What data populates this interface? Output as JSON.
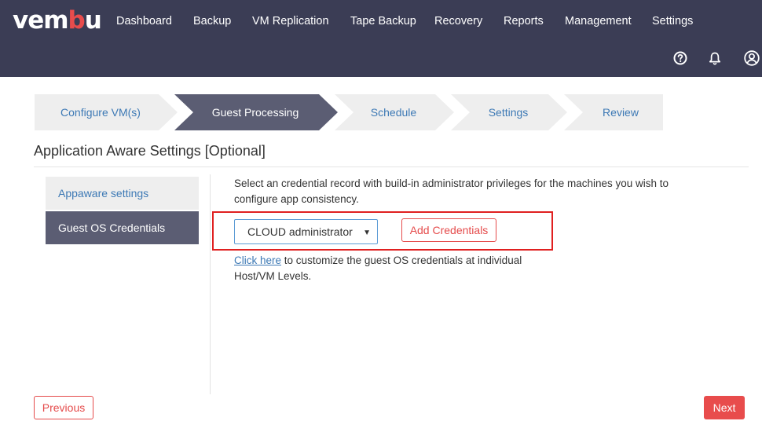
{
  "brand": {
    "logo_part1": "vem",
    "logo_part2": "b",
    "logo_part3": "u",
    "accent_color": "#e84c4c",
    "nav_bg_color": "#3b3d55"
  },
  "nav": {
    "items": [
      "Dashboard",
      "Backup",
      "VM Replication",
      "Tape Backup",
      "Recovery",
      "Reports",
      "Management",
      "Settings"
    ]
  },
  "utility_icons": [
    "help-icon",
    "bell-icon",
    "user-icon"
  ],
  "wizard": {
    "steps": [
      {
        "label": "Configure VM(s)",
        "state": "completed"
      },
      {
        "label": "Guest Processing",
        "state": "active"
      },
      {
        "label": "Schedule",
        "state": "pending"
      },
      {
        "label": "Settings",
        "state": "pending"
      },
      {
        "label": "Review",
        "state": "pending"
      }
    ]
  },
  "section": {
    "title": "Application Aware Settings [Optional]"
  },
  "sidebar": {
    "items": [
      {
        "label": "Appaware settings",
        "selected": false
      },
      {
        "label": "Guest OS Credentials",
        "selected": true
      }
    ]
  },
  "content": {
    "description": "Select an credential record with build-in administrator privileges for the machines you wish to configure app consistency.",
    "credential_select": {
      "selected": "CLOUD administrator"
    },
    "add_credentials_label": "Add Credentials",
    "click_here_link": "Click here",
    "customize_text": "to customize the guest OS credentials at individual Host/VM Levels."
  },
  "footer": {
    "previous_label": "Previous",
    "next_label": "Next"
  }
}
